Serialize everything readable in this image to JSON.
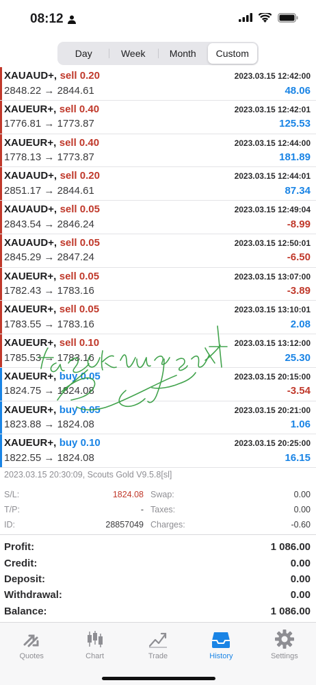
{
  "status_bar": {
    "time": "08:12"
  },
  "periods": [
    {
      "label": "Day",
      "active": false
    },
    {
      "label": "Week",
      "active": false
    },
    {
      "label": "Month",
      "active": false
    },
    {
      "label": "Custom",
      "active": true
    }
  ],
  "trades": [
    {
      "symbol": "XAUAUD+,",
      "direction": "sell 0.20",
      "type": "sell",
      "date": "2023.03.15 12:42:00",
      "open": "2848.22",
      "close": "2844.61",
      "profit": "48.06"
    },
    {
      "symbol": "XAUEUR+,",
      "direction": "sell 0.40",
      "type": "sell",
      "date": "2023.03.15 12:42:01",
      "open": "1776.81",
      "close": "1773.87",
      "profit": "125.53"
    },
    {
      "symbol": "XAUEUR+,",
      "direction": "sell 0.40",
      "type": "sell",
      "date": "2023.03.15 12:44:00",
      "open": "1778.13",
      "close": "1773.87",
      "profit": "181.89"
    },
    {
      "symbol": "XAUAUD+,",
      "direction": "sell 0.20",
      "type": "sell",
      "date": "2023.03.15 12:44:01",
      "open": "2851.17",
      "close": "2844.61",
      "profit": "87.34"
    },
    {
      "symbol": "XAUAUD+,",
      "direction": "sell 0.05",
      "type": "sell",
      "date": "2023.03.15 12:49:04",
      "open": "2843.54",
      "close": "2846.24",
      "profit": "-8.99"
    },
    {
      "symbol": "XAUAUD+,",
      "direction": "sell 0.05",
      "type": "sell",
      "date": "2023.03.15 12:50:01",
      "open": "2845.29",
      "close": "2847.24",
      "profit": "-6.50"
    },
    {
      "symbol": "XAUEUR+,",
      "direction": "sell 0.05",
      "type": "sell",
      "date": "2023.03.15 13:07:00",
      "open": "1782.43",
      "close": "1783.16",
      "profit": "-3.89"
    },
    {
      "symbol": "XAUEUR+,",
      "direction": "sell 0.05",
      "type": "sell",
      "date": "2023.03.15 13:10:01",
      "open": "1783.55",
      "close": "1783.16",
      "profit": "2.08"
    },
    {
      "symbol": "XAUEUR+,",
      "direction": "sell 0.10",
      "type": "sell",
      "date": "2023.03.15 13:12:00",
      "open": "1785.53",
      "close": "1783.16",
      "profit": "25.30"
    },
    {
      "symbol": "XAUEUR+,",
      "direction": "buy 0.05",
      "type": "buy",
      "date": "2023.03.15 20:15:00",
      "open": "1824.75",
      "close": "1824.08",
      "profit": "-3.54"
    },
    {
      "symbol": "XAUEUR+,",
      "direction": "buy 0.05",
      "type": "buy",
      "date": "2023.03.15 20:21:00",
      "open": "1823.88",
      "close": "1824.08",
      "profit": "1.06"
    },
    {
      "symbol": "XAUEUR+,",
      "direction": "buy 0.10",
      "type": "buy",
      "date": "2023.03.15 20:25:00",
      "open": "1822.55",
      "close": "1824.08",
      "profit": "16.15"
    }
  ],
  "detail": {
    "header": "2023.03.15 20:30:09, Scouts Gold V9.5.8[sl]",
    "sl_label": "S/L:",
    "sl_value": "1824.08",
    "tp_label": "T/P:",
    "tp_value": "-",
    "id_label": "ID:",
    "id_value": "28857049",
    "swap_label": "Swap:",
    "swap_value": "0.00",
    "taxes_label": "Taxes:",
    "taxes_value": "0.00",
    "charges_label": "Charges:",
    "charges_value": "-0.60"
  },
  "summary": [
    {
      "label": "Profit:",
      "value": "1 086.00"
    },
    {
      "label": "Credit:",
      "value": "0.00"
    },
    {
      "label": "Deposit:",
      "value": "0.00"
    },
    {
      "label": "Withdrawal:",
      "value": "0.00"
    },
    {
      "label": "Balance:",
      "value": "1 086.00"
    }
  ],
  "tabs": [
    {
      "label": "Quotes",
      "icon": "quotes-icon",
      "active": false
    },
    {
      "label": "Chart",
      "icon": "chart-icon",
      "active": false
    },
    {
      "label": "Trade",
      "icon": "trade-icon",
      "active": false
    },
    {
      "label": "History",
      "icon": "history-icon",
      "active": true
    },
    {
      "label": "Settings",
      "icon": "gear-icon",
      "active": false
    }
  ],
  "colors": {
    "sell": "#c0392b",
    "buy": "#1a84e5",
    "profit_positive": "#1a84e5",
    "profit_negative": "#c0392b",
    "accent": "#1a84e5",
    "watermark": "#2e9a3a"
  }
}
